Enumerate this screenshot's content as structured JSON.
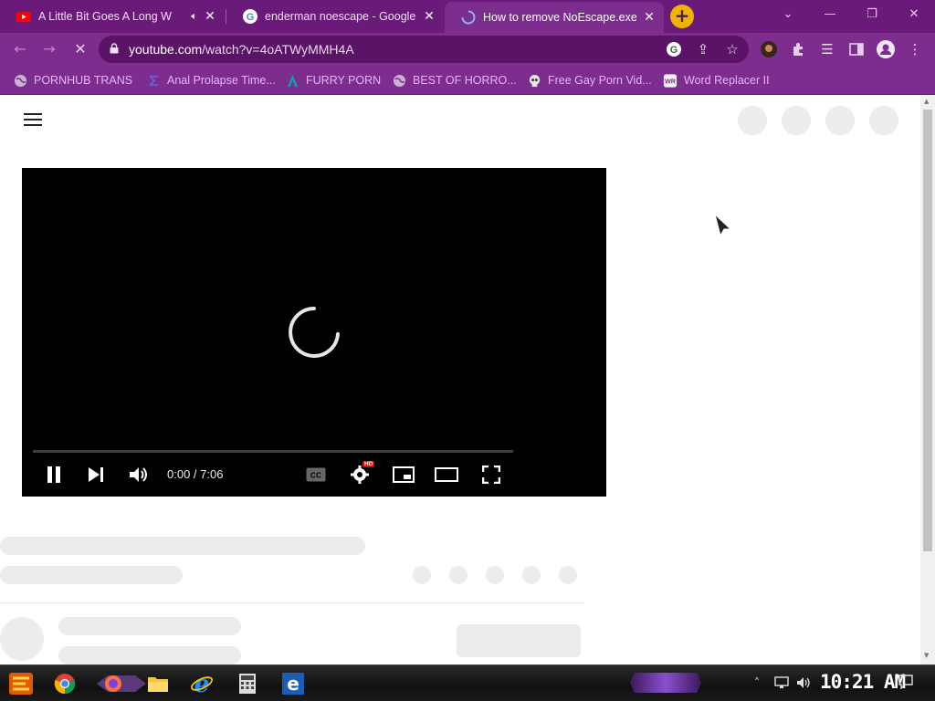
{
  "tabs": [
    {
      "title": "A Little Bit Goes A Long W",
      "favicon": "youtube-icon",
      "audio": true
    },
    {
      "title": "enderman noescape - Google Se",
      "favicon": "google-icon"
    },
    {
      "title": "How to remove NoEscape.exe [",
      "favicon": "loading-icon",
      "active": true
    }
  ],
  "tab_close": "✕",
  "new_tab": "+",
  "address": {
    "host": "youtube.com",
    "path": "/watch?v=4oATWyMMH4A"
  },
  "bookmarks": [
    {
      "label": "PORNHUB TRANS",
      "icon": "globe-icon"
    },
    {
      "label": "Anal Prolapse Time...",
      "icon": "sigma-icon"
    },
    {
      "label": "FURRY PORN",
      "icon": "lambda-icon"
    },
    {
      "label": "BEST OF HORRO...",
      "icon": "globe-icon"
    },
    {
      "label": "Free Gay Porn Vid...",
      "icon": "skull-icon"
    },
    {
      "label": "Word Replacer II",
      "icon": "wr-icon"
    }
  ],
  "player": {
    "time": "0:00 / 7:06",
    "hd_badge": "HD",
    "state": "loading"
  },
  "taskbar": {
    "clock": "10:21 AM"
  },
  "colors": {
    "theme": "#7c2d8e",
    "tab_strip": "#6a1b7a",
    "new_tab": "#f0b400",
    "bookmark_text": "#e6b6ff"
  }
}
